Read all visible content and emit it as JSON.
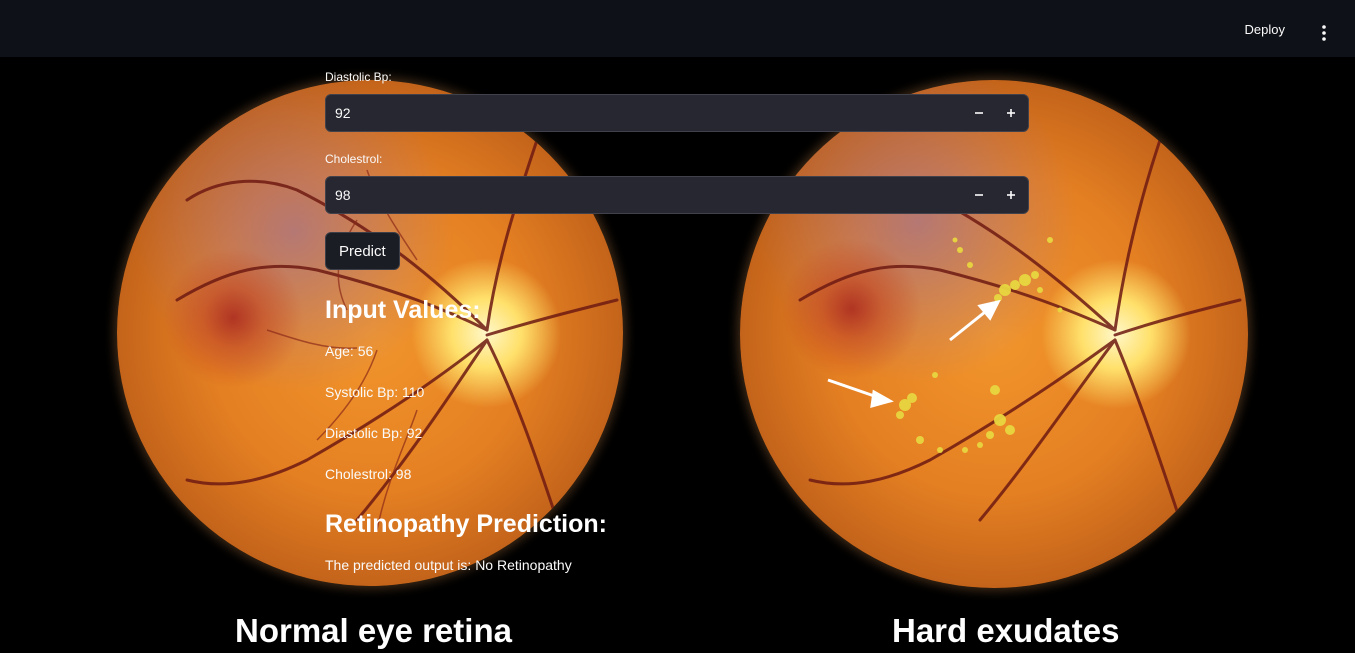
{
  "header": {
    "deploy_label": "Deploy",
    "menu_icon": "vertical-ellipsis-icon"
  },
  "form": {
    "diastolic": {
      "label": "Diastolic Bp:",
      "value": "92"
    },
    "cholesterol": {
      "label": "Cholestrol:",
      "value": "98"
    },
    "predict_label": "Predict"
  },
  "input_values": {
    "title": "Input Values:",
    "lines": [
      "Age: 56",
      "Systolic Bp: 110",
      "Diastolic Bp: 92",
      "Cholestrol: 98"
    ]
  },
  "prediction": {
    "title": "Retinopathy Prediction:",
    "text": "The predicted output is: No Retinopathy"
  },
  "images": {
    "left_caption": "Normal eye retina",
    "right_caption": "Hard exudates"
  },
  "colors": {
    "header_bg": "#0e1117",
    "input_bg": "#262730",
    "page_bg": "#000000"
  }
}
